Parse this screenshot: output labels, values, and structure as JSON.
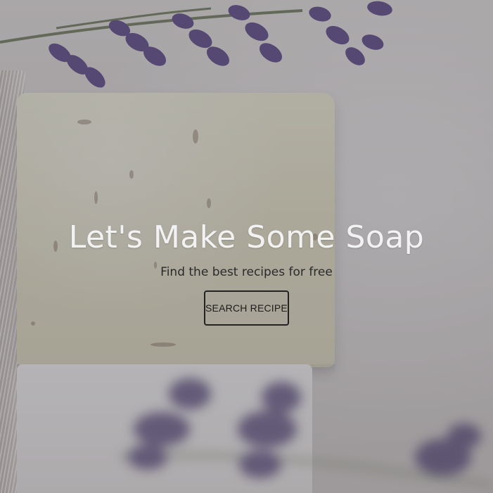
{
  "hero": {
    "title": "Let's Make Some Soap",
    "subtitle": "Find the best recipes for free",
    "cta_label": "SEARCH RECIPE"
  },
  "colors": {
    "title": "#f2f2f2",
    "subtitle": "#2a2a2a",
    "button_border": "#222222",
    "lavender": "#6d5e92"
  },
  "background_image": "lavender-soap-photo"
}
